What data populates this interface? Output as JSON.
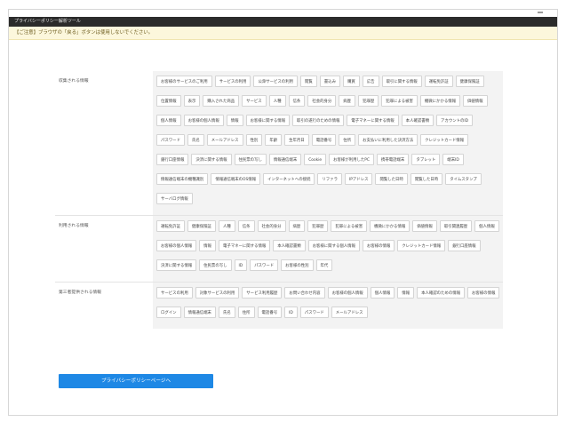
{
  "window": {
    "title": "プライバシーポリシー解析ツール"
  },
  "warning": {
    "text": "【ご注意】ブラウザの「戻る」ボタンは使用しないでください。"
  },
  "sections": [
    {
      "label": "収集される情報",
      "tags": [
        "お客様のサービスのご利用",
        "サービスの利用",
        "公衆サービスの利用",
        "閲覧",
        "書込み",
        "購買",
        "広告",
        "取引に関する情報",
        "運転免許証",
        "健康保険証",
        "位置情報",
        "表示",
        "購入された商品",
        "サービス",
        "人種",
        "信条",
        "社会的身分",
        "病歴",
        "犯罪歴",
        "犯罪による被害",
        "機微にかかる情報",
        "価値情報",
        "個人情報",
        "お客様の個人情報",
        "情報",
        "お客様に関する情報",
        "取引の遂行のための情報",
        "電子マネーに関する情報",
        "本人確認書類",
        "アカウントのID",
        "パスワード",
        "氏名",
        "メールアドレス",
        "性別",
        "年齢",
        "生年月日",
        "電話番号",
        "住所",
        "お支払いに利用した決済方法",
        "クレジットカード情報",
        "銀行口座情報",
        "決済に関する情報",
        "住民票の写し",
        "情報通信端末",
        "Cookie",
        "お客様が利用したPC",
        "携帯電話端末",
        "タブレット",
        "端末ID",
        "情報通信端末の機種識別",
        "情報通信端末のOS情報",
        "インターネットへの接続",
        "リファラ",
        "IPアドレス",
        "閲覧した日時",
        "閲覧した日時",
        "タイムスタンプ",
        "サーバログ情報"
      ]
    },
    {
      "label": "利用される情報",
      "tags": [
        "運転免許証",
        "健康保険証",
        "人種",
        "信条",
        "社会的身分",
        "病歴",
        "犯罪歴",
        "犯罪による被害",
        "機微にかかる情報",
        "価値情報",
        "取引関連履歴",
        "個人情報",
        "お客様の個人情報",
        "情報",
        "電子マネーに関する情報",
        "本人確認書類",
        "お客様に関する個人情報",
        "お客様の情報",
        "クレジットカード情報",
        "銀行口座情報",
        "決済に関する情報",
        "住民票の写し",
        "ID",
        "パスワード",
        "お客様の性別",
        "年代"
      ]
    },
    {
      "label": "第三者提供される情報",
      "tags": [
        "サービスの利用",
        "対象サービスの利用",
        "サービス利用履歴",
        "お問い合わせ内容",
        "お客様の個人情報",
        "個人情報",
        "情報",
        "本人確認のための情報",
        "お客様の情報",
        "ログイン",
        "情報通信端末",
        "氏名",
        "住所",
        "電話番号",
        "ID",
        "パスワード",
        "メールアドレス"
      ]
    }
  ],
  "button": {
    "label": "プライバシーポリシーページへ"
  }
}
